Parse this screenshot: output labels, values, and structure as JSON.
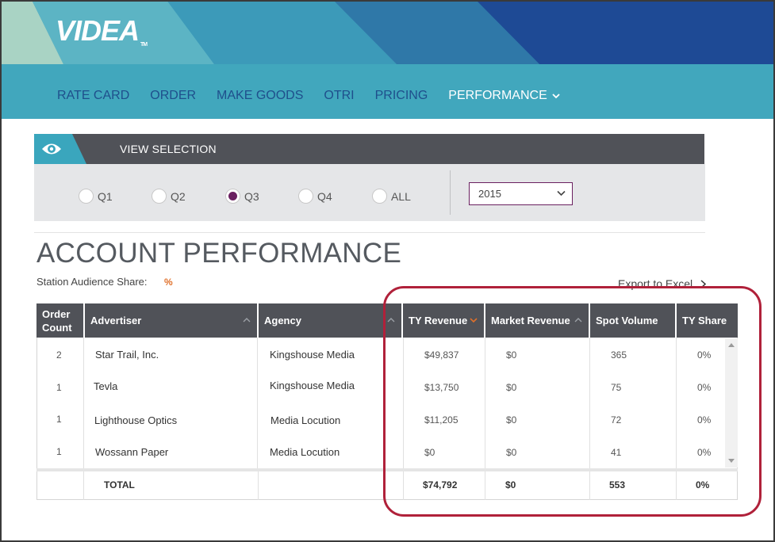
{
  "app": {
    "logo": "VIDEA",
    "logo_tm": "TM"
  },
  "nav": {
    "items": [
      "RATE CARD",
      "ORDER",
      "MAKE GOODS",
      "OTRI",
      "PRICING"
    ],
    "active": "PERFORMANCE"
  },
  "view_selection": {
    "title": "VIEW SELECTION",
    "quarters": [
      {
        "label": "Q1",
        "checked": false
      },
      {
        "label": "Q2",
        "checked": false
      },
      {
        "label": "Q3",
        "checked": true
      },
      {
        "label": "Q4",
        "checked": false
      },
      {
        "label": "ALL",
        "checked": false
      }
    ],
    "year": "2015"
  },
  "performance": {
    "title": "ACCOUNT PERFORMANCE",
    "share_label": "Station Audience Share:",
    "share_value": "%",
    "export_label": "Export to Excel"
  },
  "table": {
    "headers": {
      "order_count": "Order Count",
      "advertiser": "Advertiser",
      "agency": "Agency",
      "ty_revenue": "TY Revenue",
      "market_revenue": "Market Revenue",
      "spot_volume": "Spot Volume",
      "ty_share": "TY Share"
    },
    "rows": [
      {
        "order_count": "2",
        "advertiser": "Star Trail, Inc.",
        "agency": "Kingshouse Media",
        "ty_revenue": "$49,837",
        "market_revenue": "$0",
        "spot_volume": "365",
        "ty_share": "0%"
      },
      {
        "order_count": "1",
        "advertiser": "Tevla",
        "agency": "Kingshouse Media",
        "ty_revenue": "$13,750",
        "market_revenue": "$0",
        "spot_volume": "75",
        "ty_share": "0%"
      },
      {
        "order_count": "1",
        "advertiser": "Lighthouse Optics",
        "agency": "Media Locution",
        "ty_revenue": "$11,205",
        "market_revenue": "$0",
        "spot_volume": "72",
        "ty_share": "0%"
      },
      {
        "order_count": "1",
        "advertiser": "Wossann Paper",
        "agency": "Media Locution",
        "ty_revenue": "$0",
        "market_revenue": "$0",
        "spot_volume": "41",
        "ty_share": "0%"
      }
    ],
    "total": {
      "label": "TOTAL",
      "ty_revenue": "$74,792",
      "market_revenue": "$0",
      "spot_volume": "553",
      "ty_share": "0%"
    }
  },
  "colors": {
    "accent_purple": "#6a2060",
    "highlight_red": "#b0213a",
    "header_dark": "#505258",
    "nav_teal": "#3aa6bd",
    "percent_orange": "#e0702a"
  }
}
